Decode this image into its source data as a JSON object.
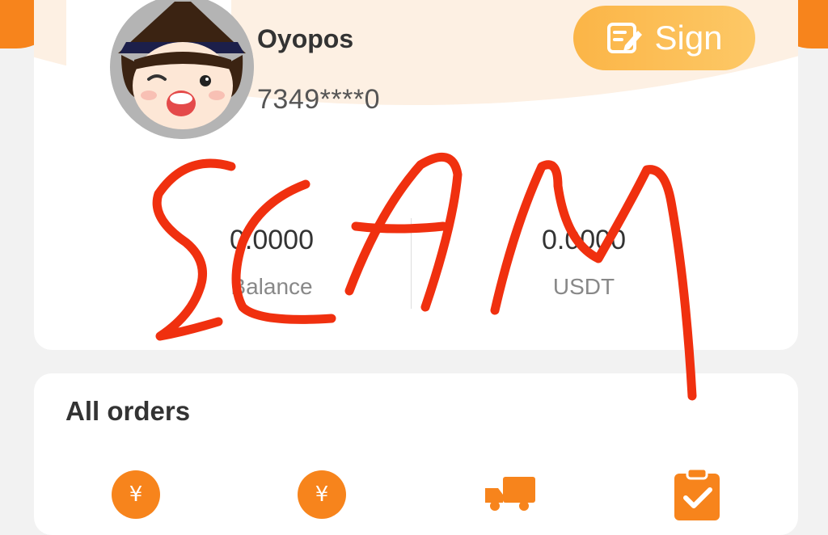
{
  "profile": {
    "username": "Oyopos",
    "user_id": "7349****0",
    "sign_label": "Sign",
    "avatar_icon": "cartoon-avatar-icon",
    "sign_icon": "edit-note-icon"
  },
  "stats": [
    {
      "value": "0.0000",
      "label": "Balance"
    },
    {
      "value": "0.0000",
      "label": "USDT"
    }
  ],
  "orders": {
    "title": "All orders",
    "icons": [
      "yen-coin-icon",
      "yen-coin-icon",
      "delivery-truck-icon",
      "clipboard-check-icon"
    ]
  },
  "overlay": {
    "text": "SCAM",
    "color": "#f0300f"
  },
  "colors": {
    "accent": "#f7841c",
    "sign_gradient_start": "#fbb547",
    "sign_gradient_end": "#fdc866",
    "peach": "#fdf0e3"
  }
}
